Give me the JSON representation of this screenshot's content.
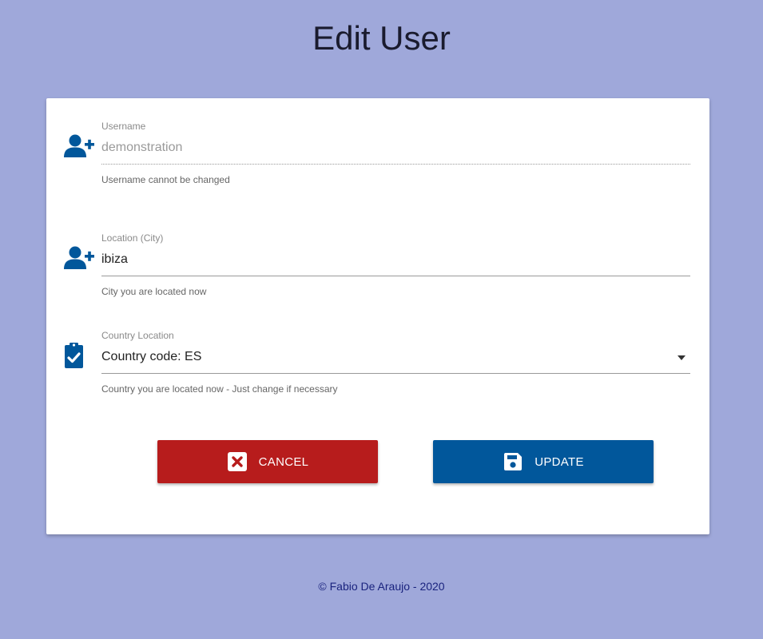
{
  "page": {
    "title": "Edit User"
  },
  "form": {
    "username": {
      "label": "Username",
      "value": "demonstration",
      "helper": "Username cannot be changed",
      "icon": "add-user-icon"
    },
    "location": {
      "label": "Location (City)",
      "value": "ibiza",
      "helper": "City you are located now",
      "icon": "add-user-icon"
    },
    "country": {
      "label": "Country Location",
      "value": "Country code: ES",
      "helper": "Country you are located now - Just change if necessary",
      "icon": "clipboard-check-icon"
    }
  },
  "actions": {
    "cancel_label": "CANCEL",
    "update_label": "UPDATE"
  },
  "footer": {
    "text": "© Fabio De Araujo - 2020"
  },
  "colors": {
    "background": "#9fa8da",
    "icon": "#01579b",
    "cancel": "#b71c1c",
    "update": "#01579b"
  }
}
